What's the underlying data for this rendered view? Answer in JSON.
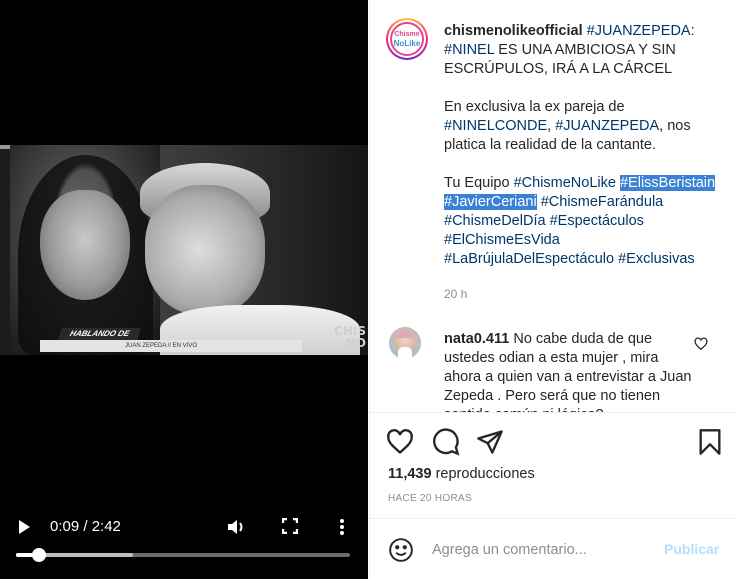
{
  "video": {
    "overlay": {
      "tag": "HABLANDO DE",
      "caption": "JUAN ZEPEDA // EN VIVO",
      "corner_brand": "CHIS NO"
    },
    "controls": {
      "time": "0:09 / 2:42",
      "played_fraction": 0.07,
      "buffered_fraction": 0.35,
      "icons": [
        "play-icon",
        "volume-icon",
        "fullscreen-icon",
        "more-icon"
      ]
    }
  },
  "post": {
    "author_avatar": {
      "line1": "Chisme",
      "line2": "NoLike"
    },
    "author": "chismenolikeofficial",
    "caption": {
      "p1": [
        {
          "type": "tag",
          "text": "#JUANZEPEDA"
        },
        {
          "type": "text",
          "text": ": "
        },
        {
          "type": "tag",
          "text": "#NINEL"
        },
        {
          "type": "text",
          "text": " ES UNA AMBICIOSA Y SIN ESCRÚPULOS, IRÁ A LA CÁRCEL"
        }
      ],
      "p2": [
        {
          "type": "text",
          "text": "En exclusiva la ex pareja de "
        },
        {
          "type": "tag",
          "text": "#NINELCONDE"
        },
        {
          "type": "text",
          "text": ", "
        },
        {
          "type": "tag",
          "text": "#JUANZEPEDA"
        },
        {
          "type": "text",
          "text": ", nos platica la realidad de la cantante."
        }
      ],
      "p3": [
        {
          "type": "text",
          "text": "Tu Equipo "
        },
        {
          "type": "tag",
          "text": "#ChismeNoLike"
        },
        {
          "type": "text",
          "text": " "
        },
        {
          "type": "sel",
          "text": "#ElissBeristain #JavierCeriani"
        },
        {
          "type": "text",
          "text": " "
        },
        {
          "type": "tag",
          "text": "#ChismeFarándula"
        },
        {
          "type": "text",
          "text": " "
        },
        {
          "type": "tag",
          "text": "#ChismeDelDía"
        },
        {
          "type": "text",
          "text": " "
        },
        {
          "type": "tag",
          "text": "#Espectáculos"
        },
        {
          "type": "text",
          "text": " "
        },
        {
          "type": "tag",
          "text": "#ElChismeEsVida"
        },
        {
          "type": "text",
          "text": " "
        },
        {
          "type": "tag",
          "text": "#LaBrújulaDelEspectáculo"
        },
        {
          "type": "text",
          "text": " "
        },
        {
          "type": "tag",
          "text": "#Exclusivas"
        }
      ]
    },
    "caption_time": "20 h",
    "comments": [
      {
        "user": "nata0.411",
        "text": "No cabe duda de que ustedes odian a esta mujer , mira ahora a quien van a entrevistar a Juan Zepeda . Pero será que no tienen sentido común ni lógica?"
      }
    ],
    "views_count": "11,439",
    "views_label": "reproducciones",
    "posted": "HACE 20 HORAS",
    "add_comment": {
      "placeholder": "Agrega un comentario...",
      "publish_label": "Publicar"
    }
  },
  "colors": {
    "hashtag": "#00376b",
    "selection": "#3b82d6",
    "publish_disabled": "#b2dffc",
    "secondary_text": "#8e8e8e"
  }
}
